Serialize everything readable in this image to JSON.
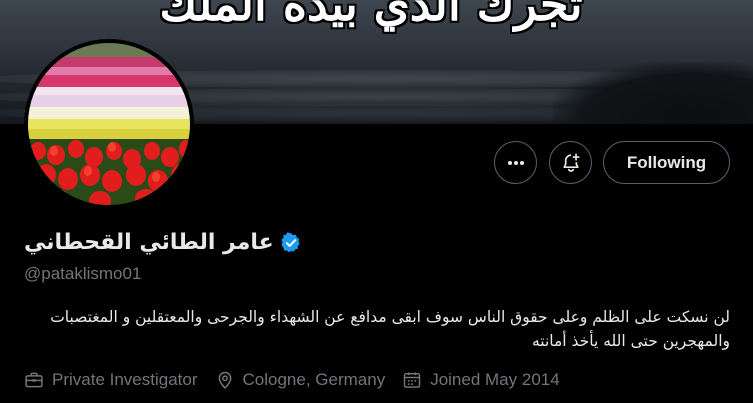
{
  "banner": {
    "overlay_text": "تجرك الذي بيده الملك"
  },
  "profile": {
    "display_name": "عامر الطائي القحطاني",
    "verified": true,
    "handle": "@pataklismo01",
    "bio": "لن نسكت على الظلم وعلى حقوق الناس سوف ابقى مدافع عن الشهداء والجرحى والمعتقلين و المغتصبات والمهجرين حتى الله يأخذ أمانته",
    "profession": "Private Investigator",
    "location": "Cologne, Germany",
    "joined": "Joined May 2014"
  },
  "actions": {
    "following_label": "Following"
  },
  "colors": {
    "background": "#000000",
    "text_primary": "#e7e9ea",
    "text_secondary": "#71767b",
    "border": "#536471",
    "verified_badge": "#1d9bf0"
  },
  "icons": [
    "more-icon",
    "notification-bell-icon",
    "verified-badge-icon",
    "briefcase-icon",
    "location-pin-icon",
    "calendar-icon"
  ]
}
